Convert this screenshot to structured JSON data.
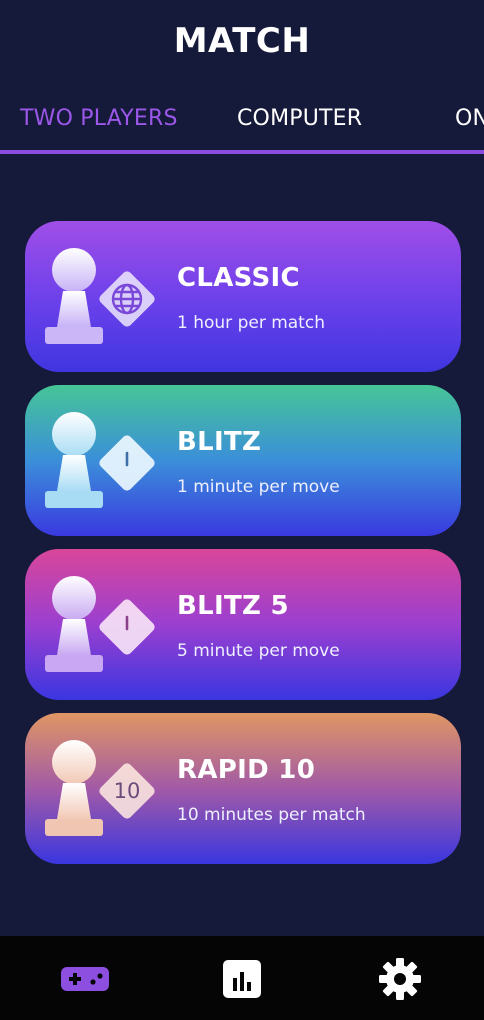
{
  "header": {
    "title": "MATCH"
  },
  "tabs": [
    {
      "label": "TWO PLAYERS",
      "active": true
    },
    {
      "label": "COMPUTER",
      "active": false
    },
    {
      "label": "ON",
      "active": false
    }
  ],
  "modes": [
    {
      "title": "CLASSIC",
      "subtitle": "1 hour per match",
      "badge_icon": "globe-icon",
      "badge_text": ""
    },
    {
      "title": "BLITZ",
      "subtitle": "1 minute per move",
      "badge_icon": "clock-icon",
      "badge_text": ""
    },
    {
      "title": "BLITZ 5",
      "subtitle": "5 minute per move",
      "badge_icon": "clock-icon",
      "badge_text": ""
    },
    {
      "title": "RAPID 10",
      "subtitle": "10 minutes per match",
      "badge_icon": "number-badge",
      "badge_text": "10"
    }
  ],
  "bottom_nav": [
    {
      "icon": "gamepad-icon",
      "active": true
    },
    {
      "icon": "stats-icon",
      "active": false
    },
    {
      "icon": "gear-icon",
      "active": false
    }
  ],
  "colors": {
    "background": "#161a3a",
    "accent": "#9a57e8",
    "nav_background": "#050505"
  }
}
